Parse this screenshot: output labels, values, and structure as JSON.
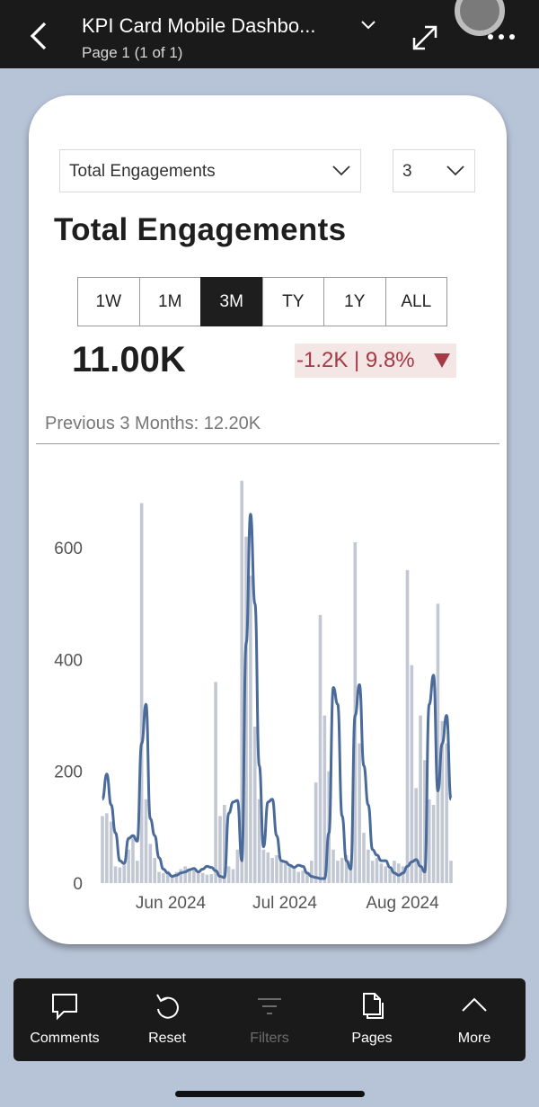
{
  "header": {
    "title": "KPI Card Mobile Dashbo...",
    "subtitle": "Page 1 (1 of 1)"
  },
  "card": {
    "metric_select": "Total Engagements",
    "count_select": "3",
    "metric_title": "Total Engagements",
    "periods": [
      "1W",
      "1M",
      "3M",
      "TY",
      "1Y",
      "ALL"
    ],
    "active_period": "3M",
    "kpi_value": "11.00K",
    "kpi_change": "-1.2K | 9.8%",
    "kpi_change_color": "#a33a45",
    "previous_text": "Previous 3 Months: 12.20K"
  },
  "chart_data": {
    "type": "line",
    "y_ticks": [
      "600",
      "400",
      "200",
      "0"
    ],
    "x_labels": [
      "Jun 2024",
      "Jul 2024",
      "Aug 2024"
    ],
    "ylim": [
      0,
      750
    ],
    "bar_color": "#c2c8d3",
    "line_color": "#4a6a9a",
    "bars": [
      120,
      125,
      110,
      30,
      28,
      32,
      60,
      85,
      40,
      680,
      150,
      70,
      45,
      20,
      18,
      22,
      15,
      20,
      25,
      30,
      22,
      25,
      20,
      18,
      15,
      16,
      360,
      120,
      140,
      30,
      25,
      60,
      720,
      620,
      550,
      280,
      150,
      60,
      55,
      45,
      50,
      40,
      35,
      30,
      28,
      20,
      22,
      18,
      40,
      180,
      480,
      300,
      200,
      60,
      40,
      45,
      50,
      40,
      610,
      250,
      90,
      60,
      40,
      45,
      35,
      30,
      25,
      40,
      35,
      30,
      560,
      390,
      170,
      300,
      220,
      150,
      140,
      500,
      290,
      250,
      40
    ],
    "line": [
      150,
      195,
      140,
      90,
      40,
      35,
      80,
      85,
      75,
      250,
      320,
      115,
      85,
      45,
      25,
      18,
      12,
      14,
      18,
      20,
      24,
      26,
      20,
      25,
      30,
      28,
      22,
      12,
      10,
      125,
      145,
      148,
      40,
      430,
      660,
      500,
      210,
      65,
      145,
      150,
      85,
      40,
      38,
      32,
      28,
      32,
      30,
      18,
      12,
      10,
      8,
      8,
      90,
      350,
      320,
      120,
      40,
      25,
      300,
      355,
      210,
      140,
      60,
      50,
      40,
      40,
      28,
      18,
      14,
      18,
      30,
      38,
      42,
      30,
      20,
      320,
      372,
      165,
      250,
      300,
      150
    ]
  },
  "tabbar": {
    "tabs": [
      {
        "label": "Comments",
        "icon": "comment-icon",
        "enabled": true
      },
      {
        "label": "Reset",
        "icon": "reset-icon",
        "enabled": true
      },
      {
        "label": "Filters",
        "icon": "filter-icon",
        "enabled": false
      },
      {
        "label": "Pages",
        "icon": "pages-icon",
        "enabled": true
      },
      {
        "label": "More",
        "icon": "chevron-up-icon",
        "enabled": true
      }
    ]
  }
}
